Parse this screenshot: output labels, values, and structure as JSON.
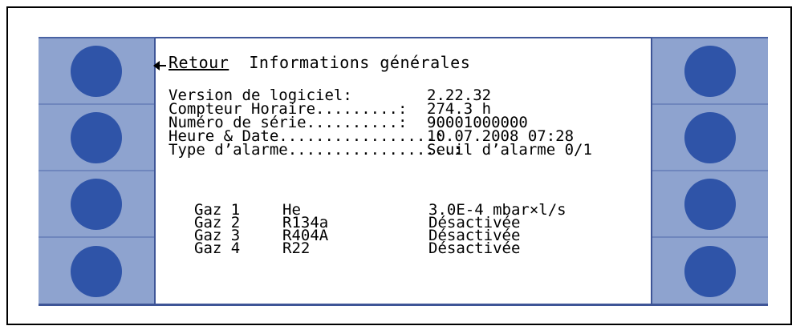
{
  "header": {
    "back_label": "Retour",
    "title": "Informations générales"
  },
  "info": [
    {
      "label": "Version de logiciel:",
      "value": "2.22.32"
    },
    {
      "label": "Compteur Horaire.........:",
      "value": "274.3 h"
    },
    {
      "label": "Numéro de série..........:",
      "value": "90001000000"
    },
    {
      "label": "Heure & Date.................:",
      "value": "10.07.2008 07:28"
    },
    {
      "label": "Type d’alarme..................:",
      "value": "Seuil d’alarme 0/1"
    }
  ],
  "gases": [
    {
      "name": "Gaz 1",
      "fluid": "He",
      "value": "3.0E-4 mbar×l/s"
    },
    {
      "name": "Gaz 2",
      "fluid": "R134a",
      "value": "Désactivée"
    },
    {
      "name": "Gaz 3",
      "fluid": "R404A",
      "value": "Désactivée"
    },
    {
      "name": "Gaz 4",
      "fluid": "R22",
      "value": "Désactivée"
    }
  ],
  "colors": {
    "panel": "#8ea3cf",
    "button": "#2f54a8",
    "border": "#3e5597"
  },
  "icons": {
    "soft_key": "circle-button-icon",
    "back": "back-arrow-icon"
  }
}
